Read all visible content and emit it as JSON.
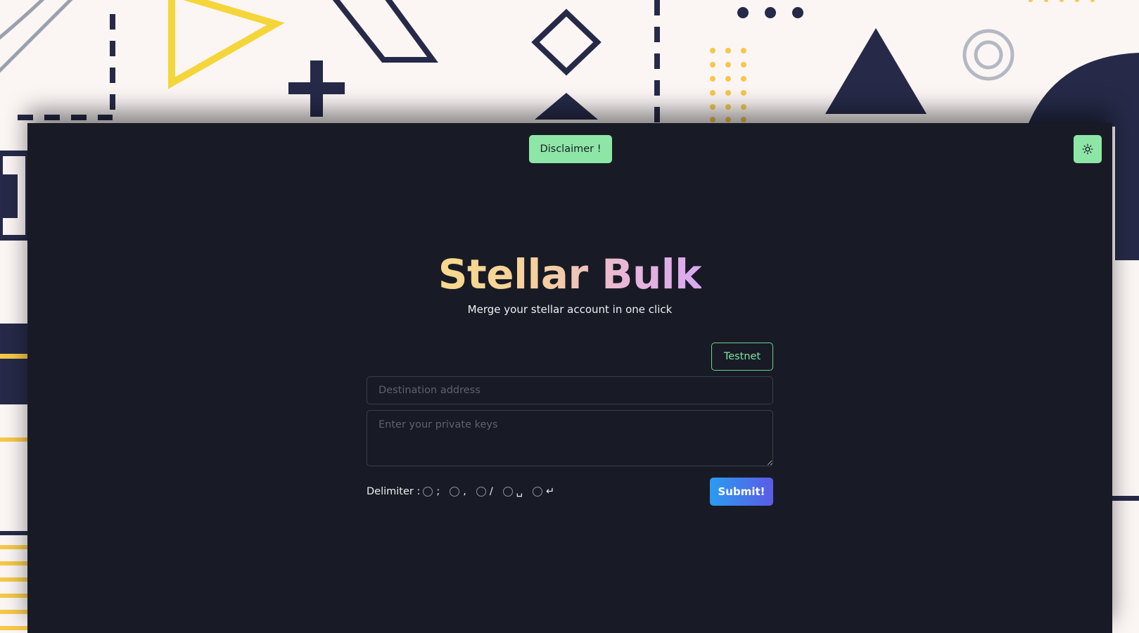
{
  "header": {
    "disclaimer_label": "Disclaimer !",
    "theme_toggle_icon": "sun-icon"
  },
  "hero": {
    "title": "Stellar Bulk",
    "subtitle": "Merge your stellar account in one click"
  },
  "form": {
    "network_label": "Testnet",
    "destination": {
      "placeholder": "Destination address",
      "value": ""
    },
    "private_keys": {
      "placeholder": "Enter your private keys",
      "value": ""
    },
    "delimiter_label": "Delimiter :",
    "delimiter_options": [
      ";",
      ",",
      "/",
      "␣",
      "↵"
    ],
    "submit_label": "Submit!"
  },
  "colors": {
    "app_background": "#181b25",
    "accent_green": "#8ee6a6",
    "submit_gradient_start": "#2b9cf0",
    "submit_gradient_end": "#5a5be6",
    "title_gradient_start": "#f7d98b",
    "title_gradient_end": "#d9a8f2"
  }
}
